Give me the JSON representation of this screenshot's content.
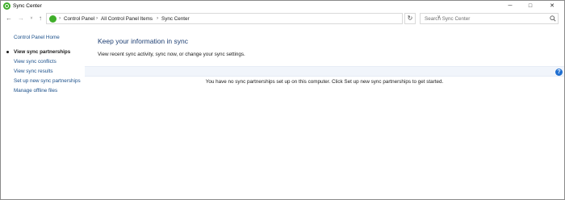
{
  "window": {
    "title": "Sync Center",
    "buttons": {
      "minimize": "─",
      "maximize": "□",
      "close": "✕"
    }
  },
  "nav": {
    "back": "←",
    "forward": "→",
    "recent": "˅",
    "up": "↑",
    "breadcrumb": [
      "Control Panel",
      "All Control Panel Items",
      "Sync Center"
    ],
    "separator": "›",
    "dropdown": "˅",
    "refresh": "↻",
    "search_placeholder": "Search Sync Center"
  },
  "sidebar": {
    "home": "Control Panel Home",
    "tasks": [
      {
        "label": "View sync partnerships",
        "selected": true
      },
      {
        "label": "View sync conflicts"
      },
      {
        "label": "View sync results"
      },
      {
        "label": "Set up new sync partnerships"
      },
      {
        "label": "Manage offline files"
      }
    ]
  },
  "main": {
    "heading": "Keep your information in sync",
    "description": "View recent sync activity, sync now, or change your sync settings.",
    "empty_message": "You have no sync partnerships set up on this computer. Click Set up new sync partnerships to get started.",
    "help": "?"
  },
  "colors": {
    "accent_green": "#3fae2a",
    "link_blue": "#1a4f8a",
    "heading_blue": "#1e3f73",
    "toolbar_bg": "#f1f5fb",
    "help_blue": "#1f6fd1"
  }
}
